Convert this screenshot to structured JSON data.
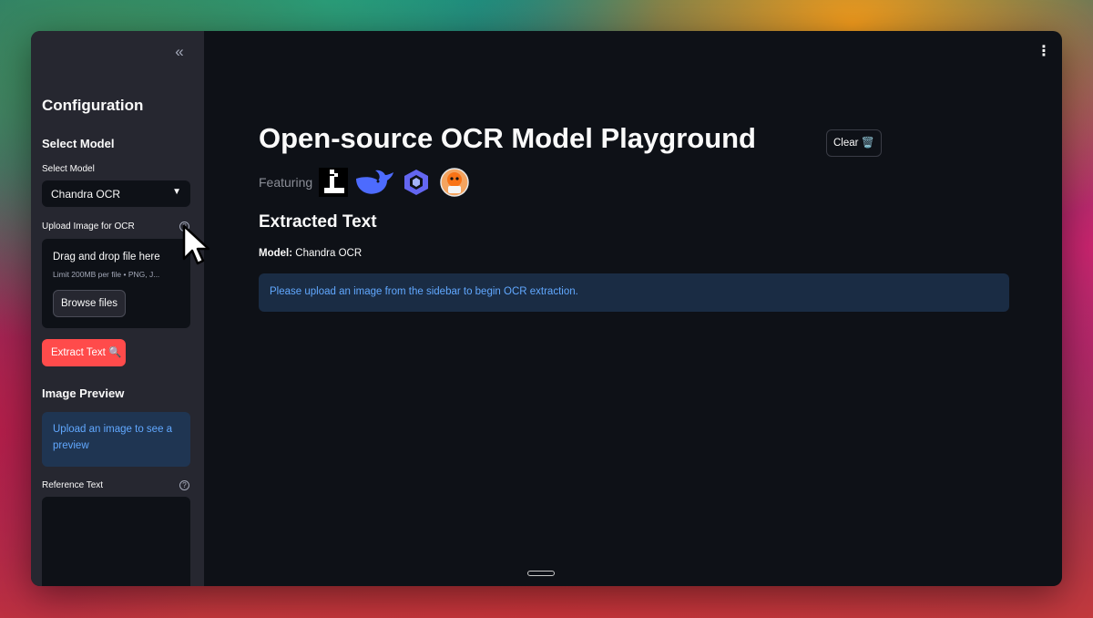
{
  "sidebar": {
    "collapse_icon": "double-chevron-left-icon",
    "heading": "Configuration",
    "select_section_title": "Select Model",
    "select_label": "Select Model",
    "selected_model": "Chandra OCR",
    "upload_label": "Upload Image for OCR",
    "dropzone_title": "Drag and drop file here",
    "dropzone_subtitle": "Limit 200MB per file • PNG, J...",
    "browse_label": "Browse files",
    "extract_label": "Extract Text 🔍",
    "preview_title": "Image Preview",
    "preview_message": "Upload an image to see a preview",
    "reference_label": "Reference Text"
  },
  "main": {
    "title": "Open-source OCR Model Playground",
    "clear_label": "Clear 🗑️",
    "featuring_label": "Featuring",
    "featured_logos": [
      "chandra-logo-icon",
      "deepseek-logo-icon",
      "qwen-logo-icon",
      "olmocr-logo-icon"
    ],
    "section_title": "Extracted Text",
    "model_label": "Model:",
    "model_value": "Chandra OCR",
    "info_message": "Please upload an image from the sidebar to begin OCR extraction."
  },
  "colors": {
    "primary_button": "#ff4b4b",
    "info_text": "#61a8ff",
    "background": "#0e1117",
    "sidebar": "#262730"
  }
}
